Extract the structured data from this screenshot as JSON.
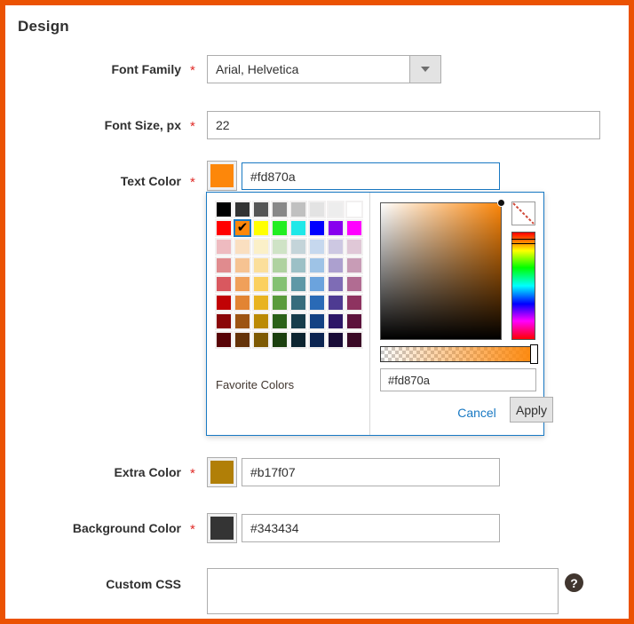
{
  "panel": {
    "border_color": "#eb5202",
    "title": "Design"
  },
  "fields": {
    "font_family": {
      "label": "Font Family",
      "required_marker": "*",
      "value": "Arial, Helvetica",
      "caret": "chevron-down-icon"
    },
    "font_size": {
      "label": "Font Size, px",
      "required_marker": "*",
      "value": "22"
    },
    "text_color": {
      "label": "Text Color",
      "required_marker": "*",
      "value": "#fd870a",
      "swatch_color": "#fd870a"
    },
    "extra_color": {
      "label": "Extra Color",
      "required_marker": "*",
      "value": "#b17f07",
      "swatch_color": "#b17f07"
    },
    "background_color": {
      "label": "Background Color",
      "required_marker": "*",
      "value": "#343434",
      "swatch_color": "#343434"
    },
    "custom_css": {
      "label": "Custom CSS",
      "value": "",
      "placeholder": "",
      "help_icon": "question-mark-icon"
    }
  },
  "color_picker": {
    "favorite_colors_label": "Favorite Colors",
    "hex_value": "#fd870a",
    "cancel_label": "Cancel",
    "apply_label": "Apply",
    "selected_swatch_index": 9,
    "selected_tick_glyph": "✔",
    "no_color_label": "no-color-icon",
    "current_color": "#fd870a",
    "swatches": [
      "#000000",
      "#333333",
      "#555555",
      "#888888",
      "#c0c0c0",
      "#e3e3e3",
      "#ededed",
      "#ffffff",
      "#ff0000",
      "#fd870a",
      "#ffff00",
      "#22ee22",
      "#20e8e8",
      "#0000ff",
      "#8800ee",
      "#ff00ff",
      "#eebbc0",
      "#fadfc0",
      "#fbf0c8",
      "#cfe3c6",
      "#c4d4d9",
      "#c6d8ee",
      "#cdc8e2",
      "#e0c8d7",
      "#e08b8e",
      "#f6c392",
      "#fbdf9b",
      "#afd2a0",
      "#9cc0c6",
      "#9ec3e6",
      "#aca0cf",
      "#c89cb6",
      "#d9585f",
      "#f0a05a",
      "#fbd05e",
      "#84c173",
      "#5f98a6",
      "#6ba3dd",
      "#7e6cb5",
      "#b16c92",
      "#c10205",
      "#e28433",
      "#e8b320",
      "#5a9b3c",
      "#376c7c",
      "#2a6ab6",
      "#4e3b92",
      "#8e3360",
      "#8a0608",
      "#9d5412",
      "#bb8a05",
      "#2b6118",
      "#173c4b",
      "#134183",
      "#2c1666",
      "#5c123c",
      "#580306",
      "#653309",
      "#7e5a04",
      "#1c400f",
      "#0d2430",
      "#0c2451",
      "#190b37",
      "#3b0a26"
    ]
  }
}
